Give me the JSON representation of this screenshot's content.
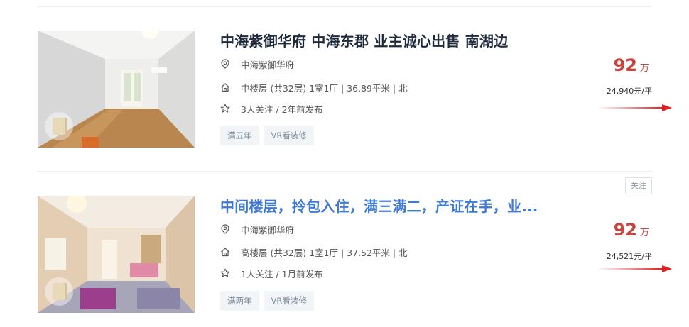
{
  "listings": [
    {
      "title": "中海紫御华府 中海东郡 业主诚心出售 南湖边",
      "community": "中海紫御华府",
      "details": "中楼层 (共32层) 1室1厅 | 36.89平米 | 北",
      "followers": "3人关注 / 2年前发布",
      "tags": [
        "满五年",
        "VR看装修"
      ],
      "price": "92",
      "price_unit": "万",
      "unit_price": "24,940元/平"
    },
    {
      "title": "中间楼层，拎包入住，满三满二，产证在手，业...",
      "community": "中海紫御华府",
      "details": "高楼层 (共32层) 1室1厅 | 37.52平米 | 北",
      "followers": "1人关注 / 1月前发布",
      "tags": [
        "满两年",
        "VR看装修"
      ],
      "price": "92",
      "price_unit": "万",
      "unit_price": "24,521元/平",
      "follow_button": "关注"
    }
  ],
  "icons": {
    "location": "location-pin-icon",
    "house": "house-icon",
    "star": "star-icon",
    "vr": "vr-badge-icon"
  },
  "colors": {
    "price": "#c8443d",
    "title_link": "#3f7ad6",
    "arrow": "#e02020"
  }
}
